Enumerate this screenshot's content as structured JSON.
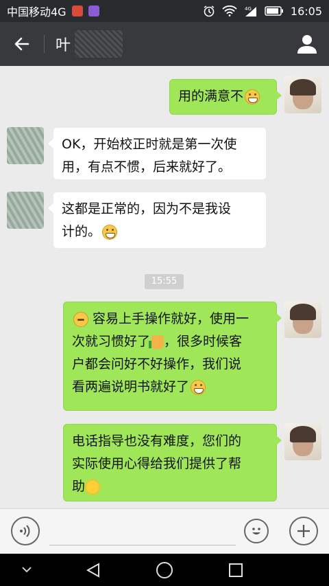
{
  "status_bar": {
    "carrier": "中国移动4G",
    "network": "4G",
    "time": "16:05"
  },
  "header": {
    "title": "叶",
    "icons": {
      "back": "arrow-left-icon",
      "profile": "person-icon"
    }
  },
  "messages": [
    {
      "from": "me",
      "text": "用的满意不",
      "emoji": "grin-emoji"
    },
    {
      "from": "other",
      "lines": [
        "OK，开始校正时就是第一次使",
        "用，有点不惯，后来就好了。"
      ]
    },
    {
      "from": "other",
      "lines": [
        "这都是正常的，因为不是我设",
        "计的。"
      ],
      "emoji": "grin-emoji"
    },
    {
      "from": "me",
      "lines": [
        " 容易上手操作就好，使用一",
        "次就习惯好了",
        "，很多时候客",
        "户都会问好不好操作，我们说",
        "看两遍说明书就好了"
      ],
      "emojis": [
        "thinking-emoji",
        "thumbs-up-emoji",
        "grin-emoji"
      ]
    },
    {
      "from": "me",
      "lines": [
        "电话指导也没有难度，您们的",
        "实际使用心得给我们提供了帮",
        "助"
      ],
      "emoji": "sun-emoji"
    }
  ],
  "timestamp": "15:55",
  "input_bar": {
    "voice_icon": "voice-icon",
    "emoji_icon": "smiley-icon",
    "plus_icon": "plus-icon"
  },
  "nav_bar": {
    "icons": [
      "dropdown-icon",
      "back-triangle-icon",
      "home-circle-icon",
      "recents-square-icon"
    ]
  }
}
